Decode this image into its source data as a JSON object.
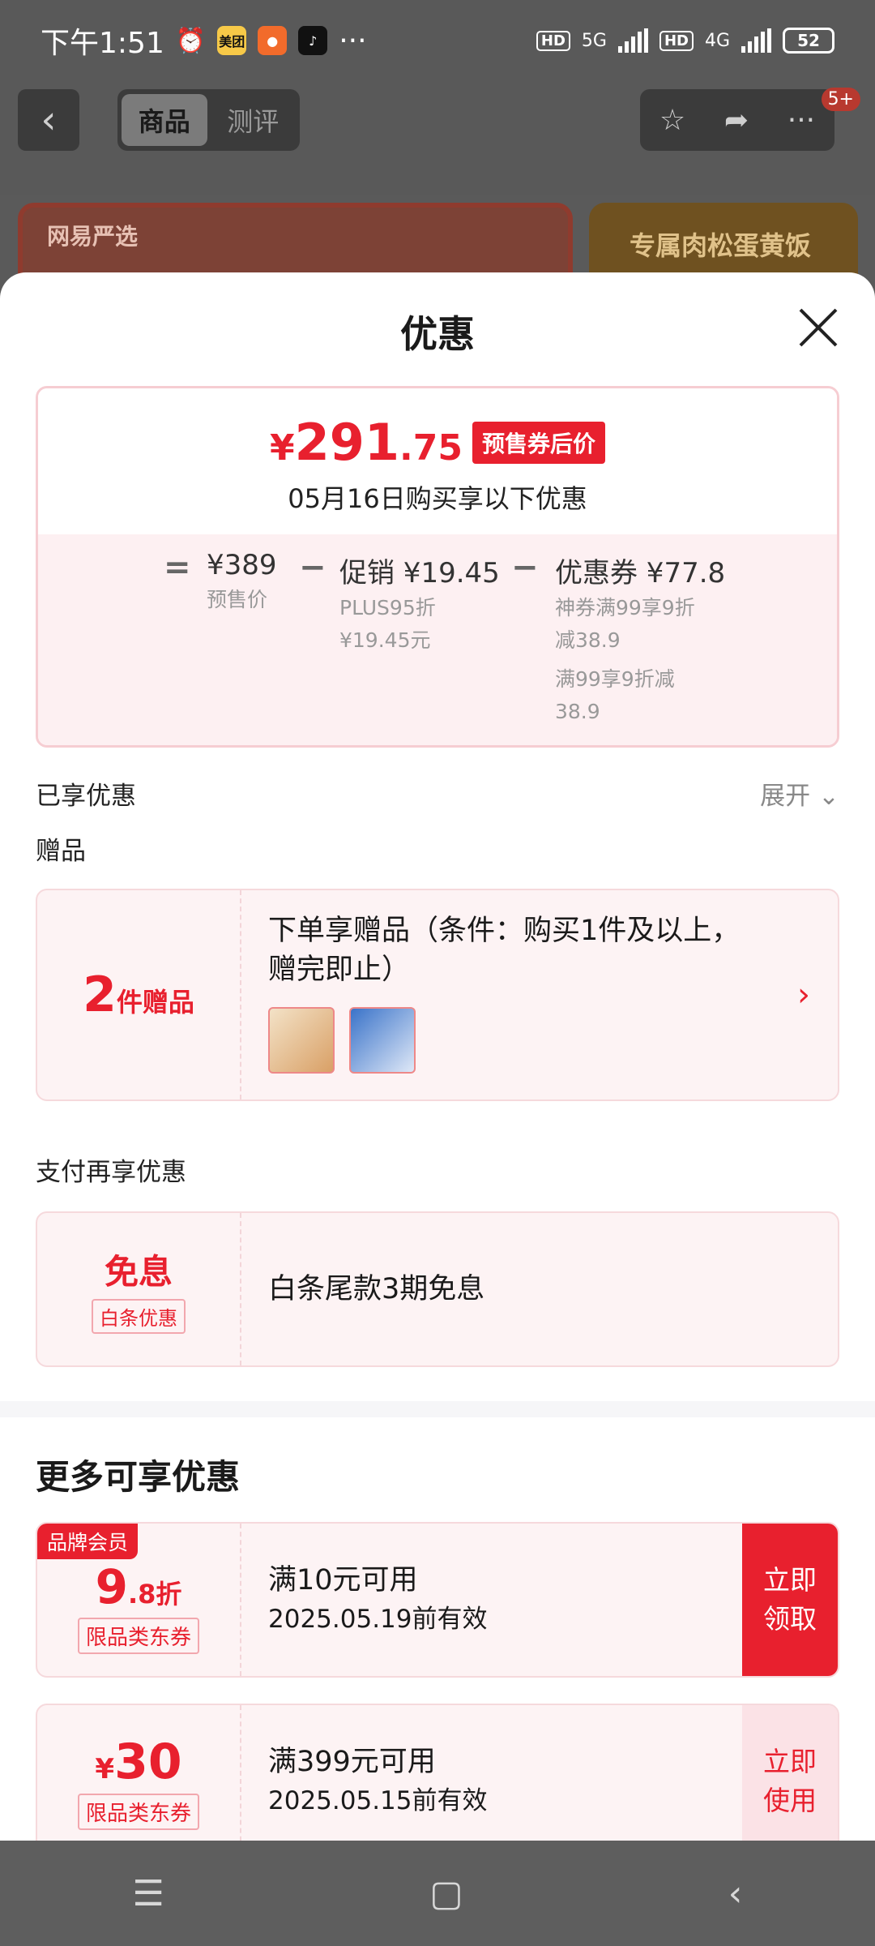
{
  "status_bar": {
    "time": "下午1:51",
    "app1": "美团",
    "battery": "52",
    "net1": "5G",
    "net2": "4G",
    "hd": "HD",
    "more": "···"
  },
  "header": {
    "tabs": [
      "商品",
      "测评"
    ],
    "badge": "5+",
    "banner_left": "网易严选",
    "banner_right": "专属肉松蛋黄饭"
  },
  "sheet": {
    "title": "优惠",
    "price_box": {
      "currency": "¥",
      "price_int": "291",
      "price_dec": ".75",
      "tag": "预售券后价",
      "subtitle": "05月16日购买享以下优惠",
      "equals": "=",
      "minus": "−",
      "presale_price": "¥389",
      "presale_label": "预售价",
      "promo_title": "促销 ¥19.45",
      "promo_line1": "PLUS95折",
      "promo_line2": "¥19.45元",
      "coupon_title": "优惠券 ¥77.8",
      "coupon_line1": "神券满99享9折",
      "coupon_line2": "减38.9",
      "coupon_line3": "满99享9折减",
      "coupon_line4": "38.9"
    },
    "enjoyed_label": "已享优惠",
    "expand_label": "展开",
    "gift_section_label": "赠品",
    "gift": {
      "count": "2",
      "count_unit": "件赠品",
      "text1": "下单享赠品（条件：购买1件及以上，",
      "text2": "赠完即止）"
    },
    "pay_section_label": "支付再享优惠",
    "pay": {
      "title": "免息",
      "tag": "白条优惠",
      "text": "白条尾款3期免息"
    },
    "more_title": "更多可享优惠",
    "coupons": [
      {
        "tag": "品牌会员",
        "val_big": "9",
        "val_small": ".8折",
        "type": "限品类东券",
        "cond": "满10元可用",
        "expire": "2025.05.19前有效",
        "btn1": "立即",
        "btn2": "领取"
      },
      {
        "tag": "",
        "val_small": "¥",
        "val_big": "30",
        "type": "限品类东券",
        "cond": "满399元可用",
        "expire": "2025.05.15前有效",
        "btn1": "立即",
        "btn2": "使用"
      }
    ]
  },
  "colors": {
    "accent": "#e8202e",
    "card_bg": "#fdf3f4"
  }
}
